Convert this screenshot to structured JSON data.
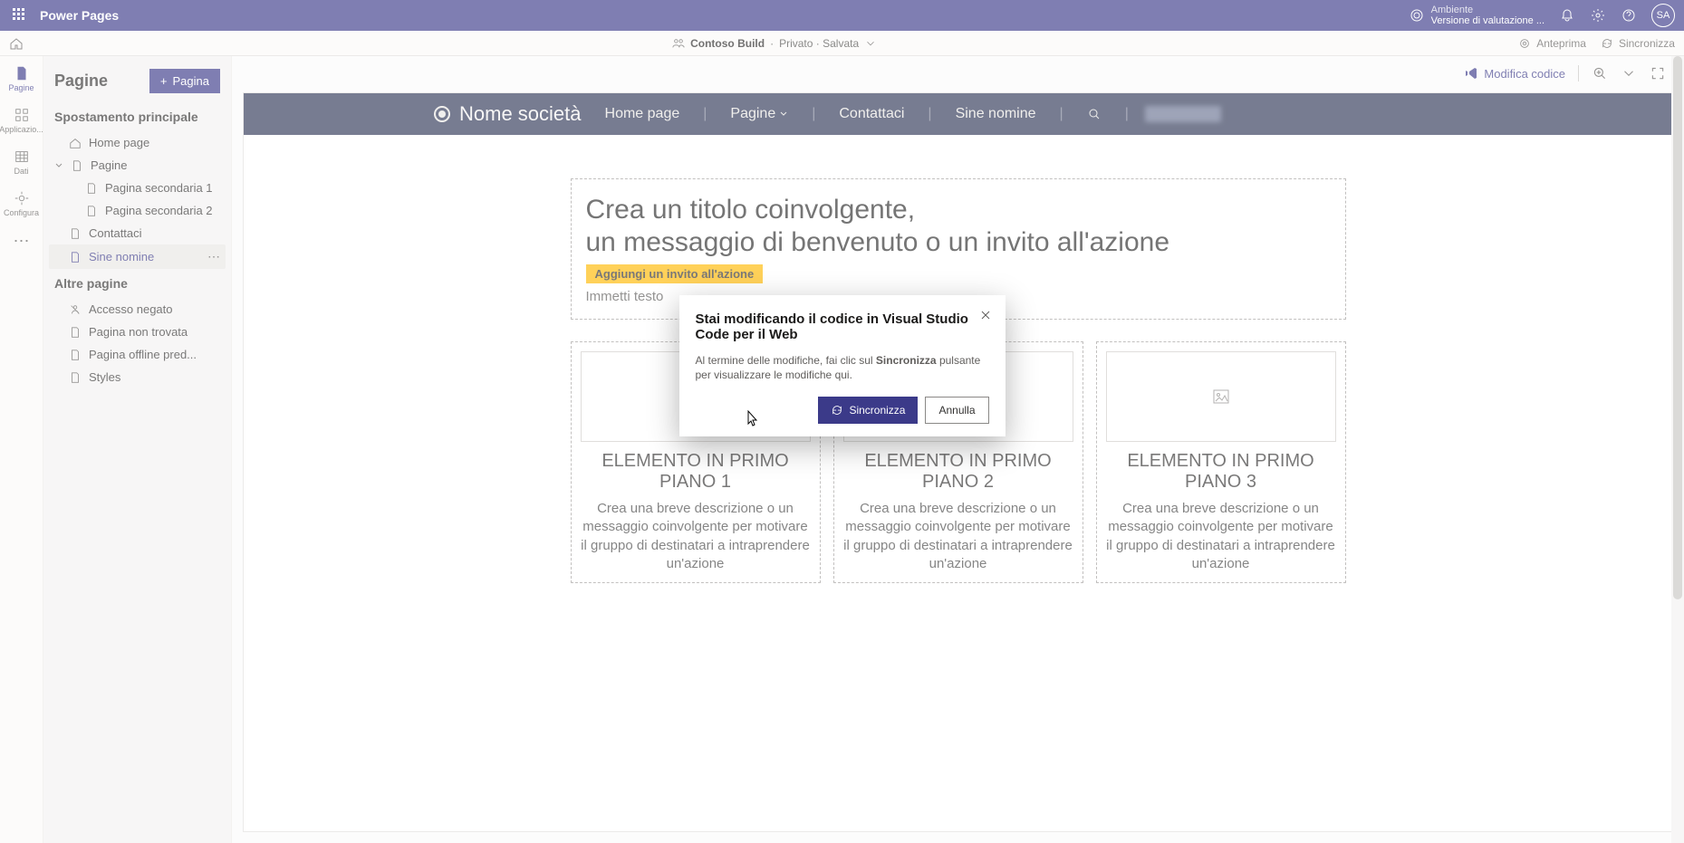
{
  "titlebar": {
    "product": "Power Pages",
    "env_label": "Ambiente",
    "env_value": "Versione di valutazione ...",
    "avatar": "SA"
  },
  "secondbar": {
    "site_name": "Contoso Build",
    "status": "Privato · Salvata",
    "preview": "Anteprima",
    "sync": "Sincronizza"
  },
  "rail": {
    "pages": "Pagine",
    "apps": "Applicazio...",
    "data": "Dati",
    "config": "Configura"
  },
  "sidebar": {
    "title": "Pagine",
    "new_page": "Pagina",
    "main_nav": "Spostamento principale",
    "items": {
      "home": "Home page",
      "pages": "Pagine",
      "sub1": "Pagina secondaria 1",
      "sub2": "Pagina secondaria 2",
      "contact": "Contattaci",
      "sinenomine": "Sine nomine"
    },
    "other": "Altre pagine",
    "other_items": {
      "denied": "Accesso negato",
      "notfound": "Pagina non trovata",
      "offline": "Pagina offline pred...",
      "styles": "Styles"
    }
  },
  "canvas_toolbar": {
    "edit_code": "Modifica codice"
  },
  "site": {
    "brand": "Nome società",
    "nav": {
      "home": "Home page",
      "pages": "Pagine",
      "contact": "Contattaci",
      "sine": "Sine nomine"
    },
    "hero": {
      "line1": "Crea un titolo coinvolgente,",
      "line2": "un messaggio di benvenuto o un invito all'azione",
      "cta": "Aggiungi un invito all'azione",
      "subtext": "Immetti testo"
    },
    "cards": [
      {
        "title": "ELEMENTO IN PRIMO PIANO 1",
        "body": "Crea una breve descrizione o un messaggio coinvolgente per motivare il gruppo di destinatari a intraprendere un'azione"
      },
      {
        "title": "ELEMENTO IN PRIMO PIANO 2",
        "body": "Crea una breve descrizione o un messaggio coinvolgente per motivare il gruppo di destinatari a intraprendere un'azione"
      },
      {
        "title": "ELEMENTO IN PRIMO PIANO 3",
        "body": "Crea una breve descrizione o un messaggio coinvolgente per motivare il gruppo di destinatari a intraprendere un'azione"
      }
    ]
  },
  "modal": {
    "title": "Stai modificando il codice in Visual Studio Code per il Web",
    "body_pre": "Al termine delle modifiche, fai clic sul ",
    "body_bold": "Sincronizza",
    "body_post": " pulsante per visualizzare le modifiche qui.",
    "primary": "Sincronizza",
    "secondary": "Annulla"
  }
}
